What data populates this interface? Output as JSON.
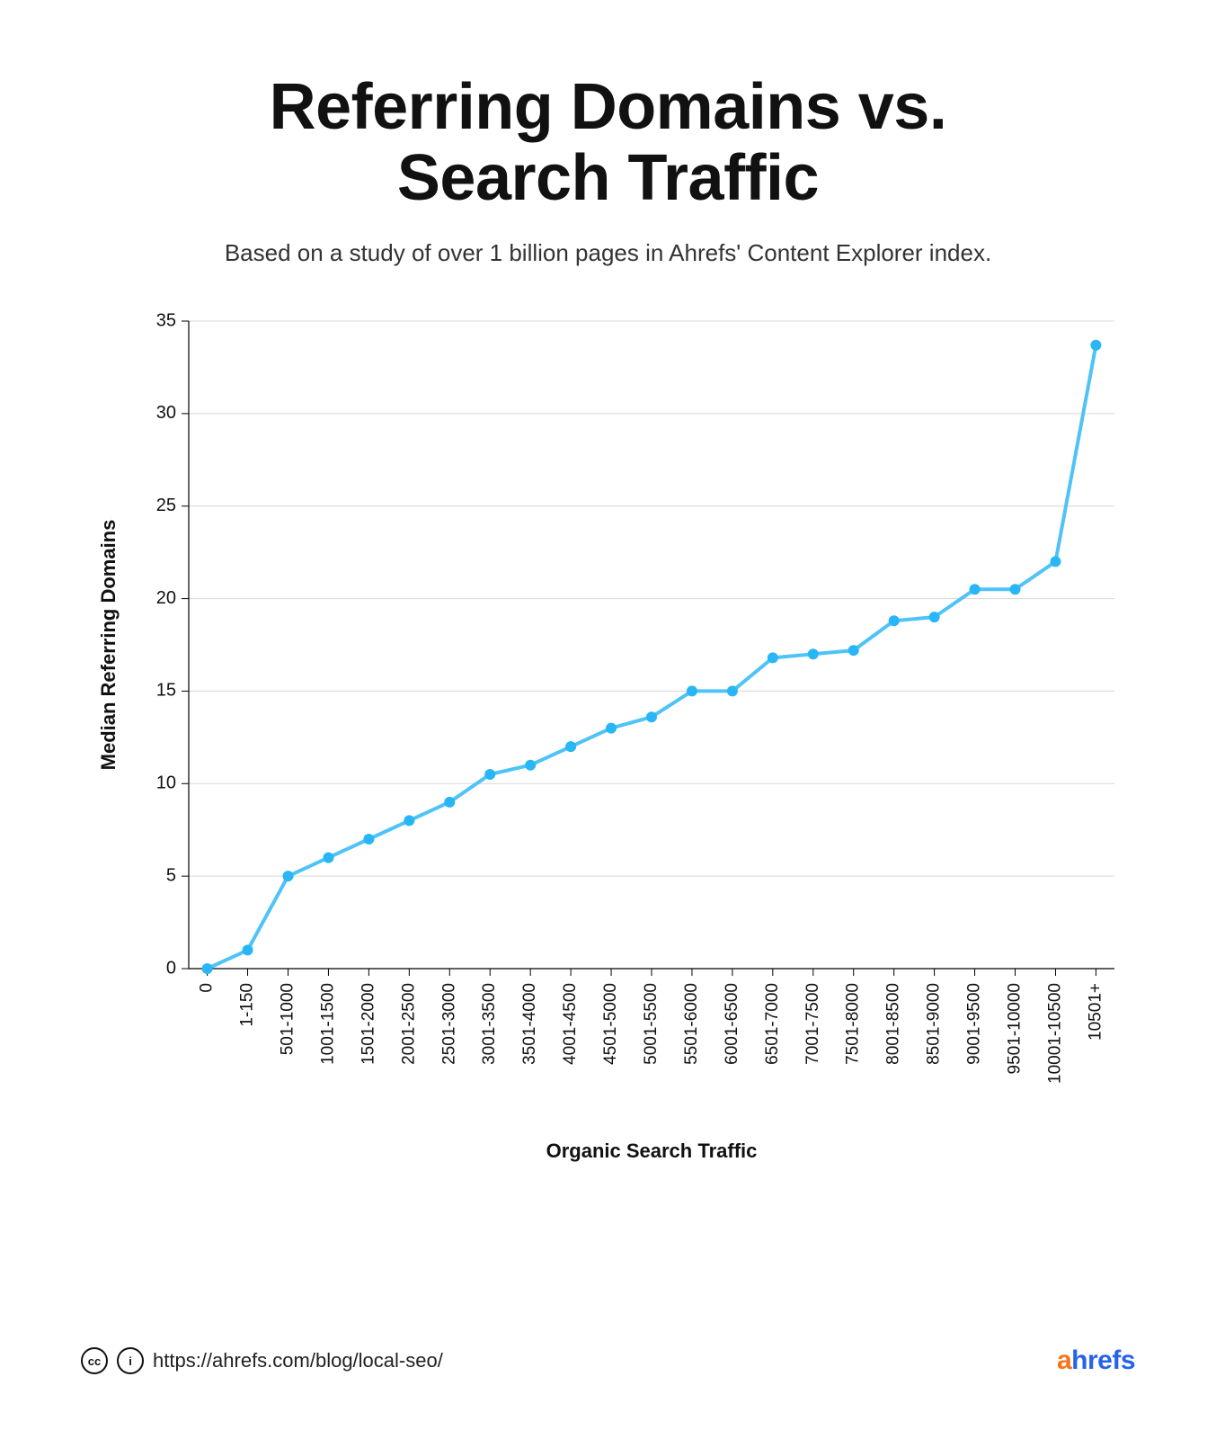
{
  "title_line1": "Referring Domains vs.",
  "title_line2": "Search Traffic",
  "subtitle": "Based on a study of over 1 billion pages in Ahrefs' Content Explorer index.",
  "chart_data": {
    "type": "line",
    "xlabel": "Organic Search Traffic",
    "ylabel": "Median Referring Domains",
    "ylim": [
      0,
      35
    ],
    "yticks": [
      0,
      5,
      10,
      15,
      20,
      25,
      30,
      35
    ],
    "categories": [
      "0",
      "1-150",
      "501-1000",
      "1001-1500",
      "1501-2000",
      "2001-2500",
      "2501-3000",
      "3001-3500",
      "3501-4000",
      "4001-4500",
      "4501-5000",
      "5001-5500",
      "5501-6000",
      "6001-6500",
      "6501-7000",
      "7001-7500",
      "7501-8000",
      "8001-8500",
      "8501-9000",
      "9001-9500",
      "9501-10000",
      "10001-10500",
      "10501+"
    ],
    "values": [
      0,
      1,
      5,
      6,
      7,
      8,
      9,
      10.5,
      11,
      12,
      13,
      13.6,
      15,
      15,
      16.8,
      17,
      17.2,
      18.8,
      19,
      20.5,
      20.5,
      22,
      33.7
    ],
    "line_color": "#4fc3f7",
    "marker_color": "#29b6f6"
  },
  "footer": {
    "cc_label": "cc",
    "by_label": "i",
    "source_url": "https://ahrefs.com/blog/local-seo/",
    "brand_a": "a",
    "brand_hrefs": "hrefs"
  }
}
